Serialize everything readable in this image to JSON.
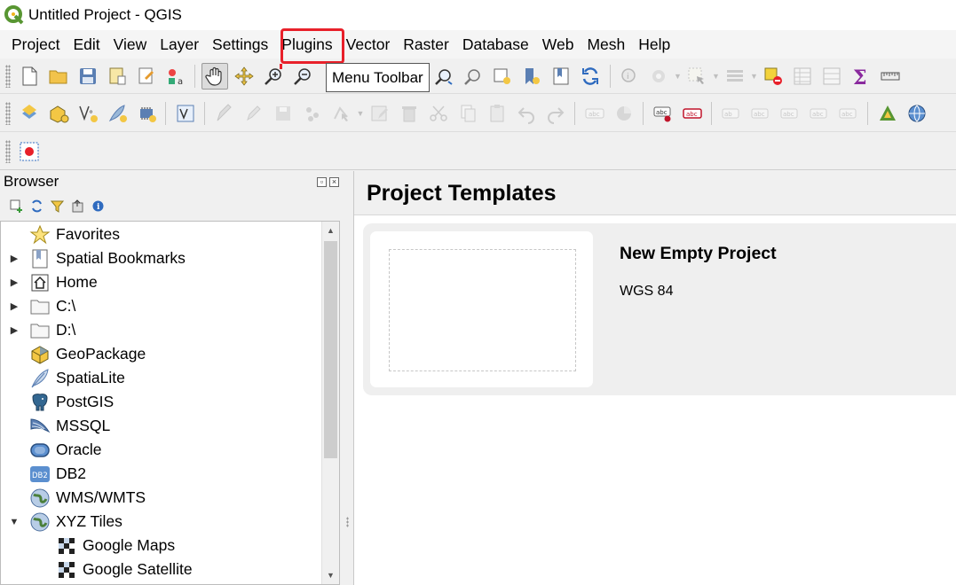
{
  "window": {
    "title": "Untitled Project - QGIS"
  },
  "menu": [
    "Project",
    "Edit",
    "View",
    "Layer",
    "Settings",
    "Plugins",
    "Vector",
    "Raster",
    "Database",
    "Web",
    "Mesh",
    "Help"
  ],
  "tooltip": "Menu Toolbar",
  "browser": {
    "title": "Browser",
    "items": [
      {
        "label": "Favorites",
        "icon": "star-icon",
        "expand": ""
      },
      {
        "label": "Spatial Bookmarks",
        "icon": "bookmark-icon",
        "expand": "right"
      },
      {
        "label": "Home",
        "icon": "home-icon",
        "expand": "right"
      },
      {
        "label": "C:\\",
        "icon": "folder-icon",
        "expand": "right"
      },
      {
        "label": "D:\\",
        "icon": "folder-icon",
        "expand": "right"
      },
      {
        "label": "GeoPackage",
        "icon": "geopackage-icon",
        "expand": ""
      },
      {
        "label": "SpatiaLite",
        "icon": "spatialite-feather-icon",
        "expand": ""
      },
      {
        "label": "PostGIS",
        "icon": "postgis-elephant-icon",
        "expand": ""
      },
      {
        "label": "MSSQL",
        "icon": "mssql-icon",
        "expand": ""
      },
      {
        "label": "Oracle",
        "icon": "oracle-icon",
        "expand": ""
      },
      {
        "label": "DB2",
        "icon": "db2-icon",
        "expand": ""
      },
      {
        "label": "WMS/WMTS",
        "icon": "globe-icon",
        "expand": ""
      },
      {
        "label": "XYZ Tiles",
        "icon": "globe-icon",
        "expand": "down"
      },
      {
        "label": "Google Maps",
        "icon": "xyz-tile-icon",
        "expand": "",
        "indent": true
      },
      {
        "label": "Google Satellite",
        "icon": "xyz-tile-icon",
        "expand": "",
        "indent": true
      }
    ]
  },
  "main": {
    "title": "Project Templates",
    "card": {
      "title": "New Empty Project",
      "subtitle": "WGS 84"
    }
  },
  "colors": {
    "annotation": "#e8202a",
    "qgis_green": "#589632"
  }
}
